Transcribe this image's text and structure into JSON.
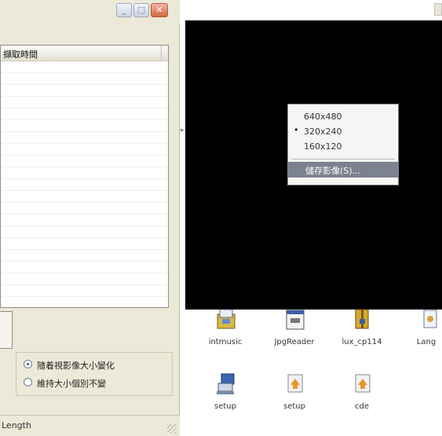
{
  "dialog": {
    "list_header": "擷取時間",
    "options": [
      {
        "label": "隨着視影像大小變化",
        "checked": true
      },
      {
        "label": "維持大小個別不變",
        "checked": false
      }
    ],
    "status_text": "Length"
  },
  "context_menu": {
    "items": [
      {
        "label": "640x480",
        "selected": false,
        "bullet": ""
      },
      {
        "label": "320x240",
        "selected": true,
        "bullet": "•"
      },
      {
        "label": "160x120",
        "selected": false,
        "bullet": ""
      }
    ],
    "save_label": "儲存影像(S)..."
  },
  "desktop_icons": [
    {
      "label": "intmusic",
      "icon": "installer-icon"
    },
    {
      "label": "JpgReader",
      "icon": "window-app-icon"
    },
    {
      "label": "lux_cp114",
      "icon": "archive-icon"
    },
    {
      "label": "Lang",
      "icon": "document-icon"
    },
    {
      "label": "setup",
      "icon": "computer-setup-icon"
    },
    {
      "label": "setup",
      "icon": "package-icon"
    },
    {
      "label": "cde",
      "icon": "package-icon"
    }
  ],
  "colors": {
    "video_background": "#000000",
    "menu_highlight": "#7c8190",
    "window_face": "#ece9d8"
  }
}
